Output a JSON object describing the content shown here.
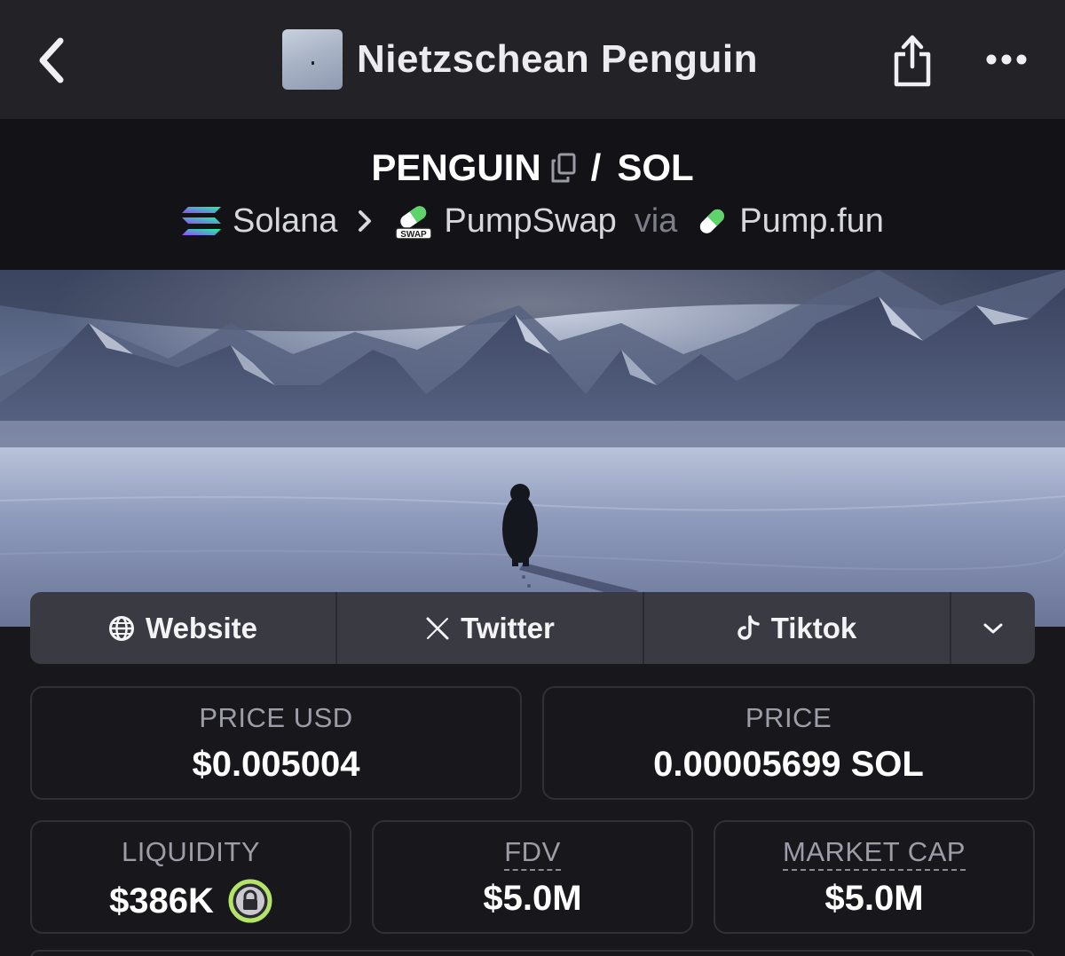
{
  "header": {
    "title": "Nietzschean Penguin"
  },
  "pair": {
    "base": "PENGUIN",
    "separator": "/",
    "quote": "SOL",
    "chain": "Solana",
    "dex": "PumpSwap",
    "via": "via",
    "launchpad": "Pump.fun",
    "dex_badge": "SWAP"
  },
  "links": [
    {
      "label": "Website",
      "icon": "globe-icon"
    },
    {
      "label": "Twitter",
      "icon": "x-icon"
    },
    {
      "label": "Tiktok",
      "icon": "tiktok-icon"
    }
  ],
  "stats": {
    "price_usd": {
      "label": "PRICE USD",
      "value": "$0.005004"
    },
    "price_native": {
      "label": "PRICE",
      "value": "0.00005699 SOL"
    },
    "liquidity": {
      "label": "LIQUIDITY",
      "value": "$386K",
      "locked": true
    },
    "fdv": {
      "label": "FDV",
      "value": "$5.0M"
    },
    "market_cap": {
      "label": "MARKET CAP",
      "value": "$5.0M"
    }
  },
  "colors": {
    "background": "#17171c",
    "topbar": "#222227",
    "pair_header": "#121217",
    "links_bar": "#3a3a42",
    "lock_ring": "#b4e36a"
  }
}
